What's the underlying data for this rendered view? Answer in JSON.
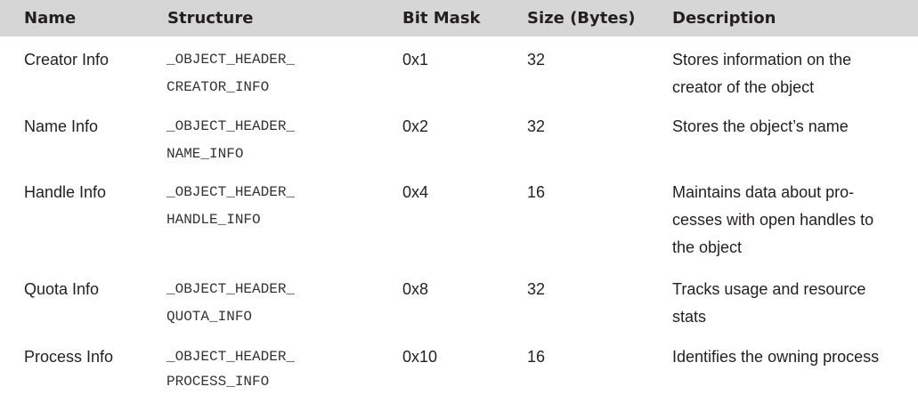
{
  "table": {
    "headers": {
      "name": "Name",
      "structure": "Structure",
      "bitmask": "Bit Mask",
      "size": "Size (Bytes)",
      "description": "Description"
    },
    "rows": [
      {
        "name": "Creator Info",
        "structure_line1": "_OBJECT_HEADER_",
        "structure_line2": "CREATOR_INFO",
        "bitmask": "0x1",
        "size": "32",
        "description_lines": [
          "Stores information on the",
          "creator of the object"
        ]
      },
      {
        "name": "Name Info",
        "structure_line1": "_OBJECT_HEADER_",
        "structure_line2": "NAME_INFO",
        "bitmask": "0x2",
        "size": "32",
        "description_lines": [
          "Stores the object’s name"
        ]
      },
      {
        "name": "Handle Info",
        "structure_line1": "_OBJECT_HEADER_",
        "structure_line2": "HANDLE_INFO",
        "bitmask": "0x4",
        "size": "16",
        "description_lines": [
          "Maintains data about pro-",
          "cesses with open handles to",
          "the object"
        ]
      },
      {
        "name": "Quota Info",
        "structure_line1": "_OBJECT_HEADER_",
        "structure_line2": "QUOTA_INFO",
        "bitmask": "0x8",
        "size": "32",
        "description_lines": [
          "Tracks usage and resource",
          "stats"
        ]
      },
      {
        "name": "Process Info",
        "structure_line1": "_OBJECT_HEADER_",
        "structure_line2": "PROCESS_INFO",
        "bitmask": "0x10",
        "size": "16",
        "description_lines": [
          "Identifies the owning process"
        ]
      }
    ]
  }
}
